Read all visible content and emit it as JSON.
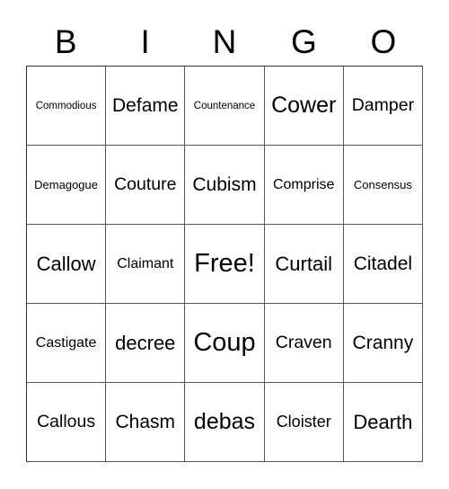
{
  "header": {
    "letters": [
      "B",
      "I",
      "N",
      "G",
      "O"
    ]
  },
  "grid": {
    "rows": [
      [
        "Commodious",
        "Defame",
        "Countenance",
        "Cower",
        "Damper"
      ],
      [
        "Demagogue",
        "Couture",
        "Cubism",
        "Comprise",
        "Consensus"
      ],
      [
        "Callow",
        "Claimant",
        "Free!",
        "Curtail",
        "Citadel"
      ],
      [
        "Castigate",
        "decree",
        "Coup",
        "Craven",
        "Cranny"
      ],
      [
        "Callous",
        "Chasm",
        "debas",
        "Cloister",
        "Dearth"
      ]
    ]
  }
}
